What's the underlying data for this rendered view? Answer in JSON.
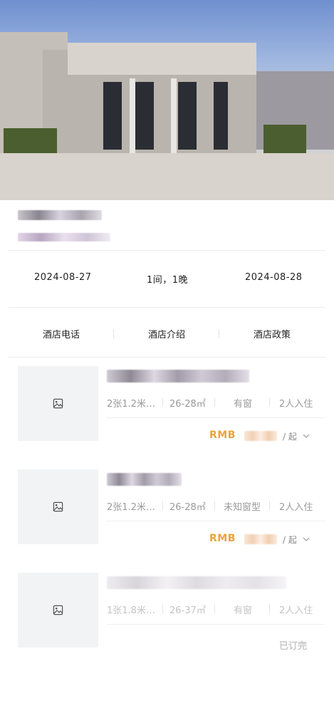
{
  "hotel": {
    "name_text": "",
    "address_text": ""
  },
  "stay": {
    "checkin": "2024-08-27",
    "rooms_nights": "1间，1晚",
    "checkout": "2024-08-28"
  },
  "tabs": [
    {
      "label": "酒店电话"
    },
    {
      "label": "酒店介绍"
    },
    {
      "label": "酒店政策"
    }
  ],
  "rooms": [
    {
      "bed": "2张1.2米…",
      "area": "26-28㎡",
      "window": "有窗",
      "guests": "2人入住",
      "price_currency": "RMB",
      "price_suffix": "/ 起",
      "status": ""
    },
    {
      "bed": "2张1.2米…",
      "area": "26-28㎡",
      "window": "未知窗型",
      "guests": "2人入住",
      "price_currency": "RMB",
      "price_suffix": "/ 起",
      "status": ""
    },
    {
      "bed": "1张1.8米…",
      "area": "26-37㎡",
      "window": "有窗",
      "guests": "2人入住",
      "price_currency": "",
      "price_suffix": "",
      "status": "已订完"
    }
  ],
  "icons": {
    "thumb_placeholder": "image-icon",
    "expand": "chevron-down-icon"
  },
  "colors": {
    "price": "#e8a53a",
    "muted": "#9a9a9a",
    "thumb_bg": "#f2f3f5"
  }
}
